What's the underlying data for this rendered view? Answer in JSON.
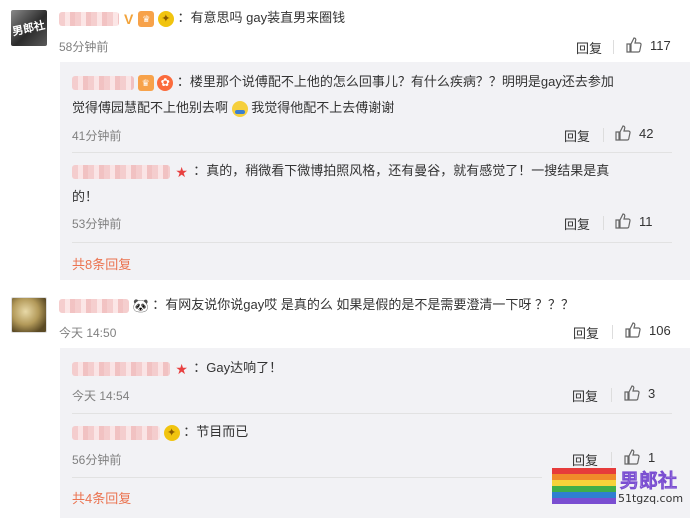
{
  "comments": [
    {
      "text": "：有意思吗 gay装直男来圈钱",
      "time": "58分钟前",
      "reply_label": "回复",
      "likes": "117",
      "avatar_watermark": "男郎社",
      "badges": [
        "v-icon",
        "vip-icon",
        "gold-medal-icon"
      ],
      "replies": [
        {
          "line1": "：楼里那个说傅配不上他的怎么回事儿？有什么疾病？？明明是gay还去参加",
          "line2a": "觉得傅园慧配不上他别去啊",
          "line2b": "我觉得他配不上去傅谢谢",
          "time": "41分钟前",
          "reply_label": "回复",
          "likes": "42"
        },
        {
          "line1": "：真的，稍微看下微博拍照风格，还有曼谷，就有感觉了！一搜结果是真",
          "line2": "的！",
          "time": "53分钟前",
          "reply_label": "回复",
          "likes": "11"
        }
      ],
      "more_replies": "共8条回复"
    },
    {
      "text": "：有网友说你说gay哎   是真的么    如果是假的是不是需要澄清一下呀 ？？？",
      "time": "今天 14:50",
      "reply_label": "回复",
      "likes": "106",
      "replies": [
        {
          "line1": "：Gay达响了！",
          "time": "今天 14:54",
          "reply_label": "回复",
          "likes": "3"
        },
        {
          "line1": "：节目而已",
          "time": "56分钟前",
          "reply_label": "回复",
          "likes": "1"
        }
      ],
      "more_replies": "共4条回复"
    }
  ],
  "watermark": {
    "brand": "男郎社",
    "url": "51tgzq.com",
    "rainbow_colors": [
      "#e63b3b",
      "#f08a2a",
      "#f5d33a",
      "#3fae49",
      "#2f7fd1",
      "#7a4ed1"
    ]
  }
}
